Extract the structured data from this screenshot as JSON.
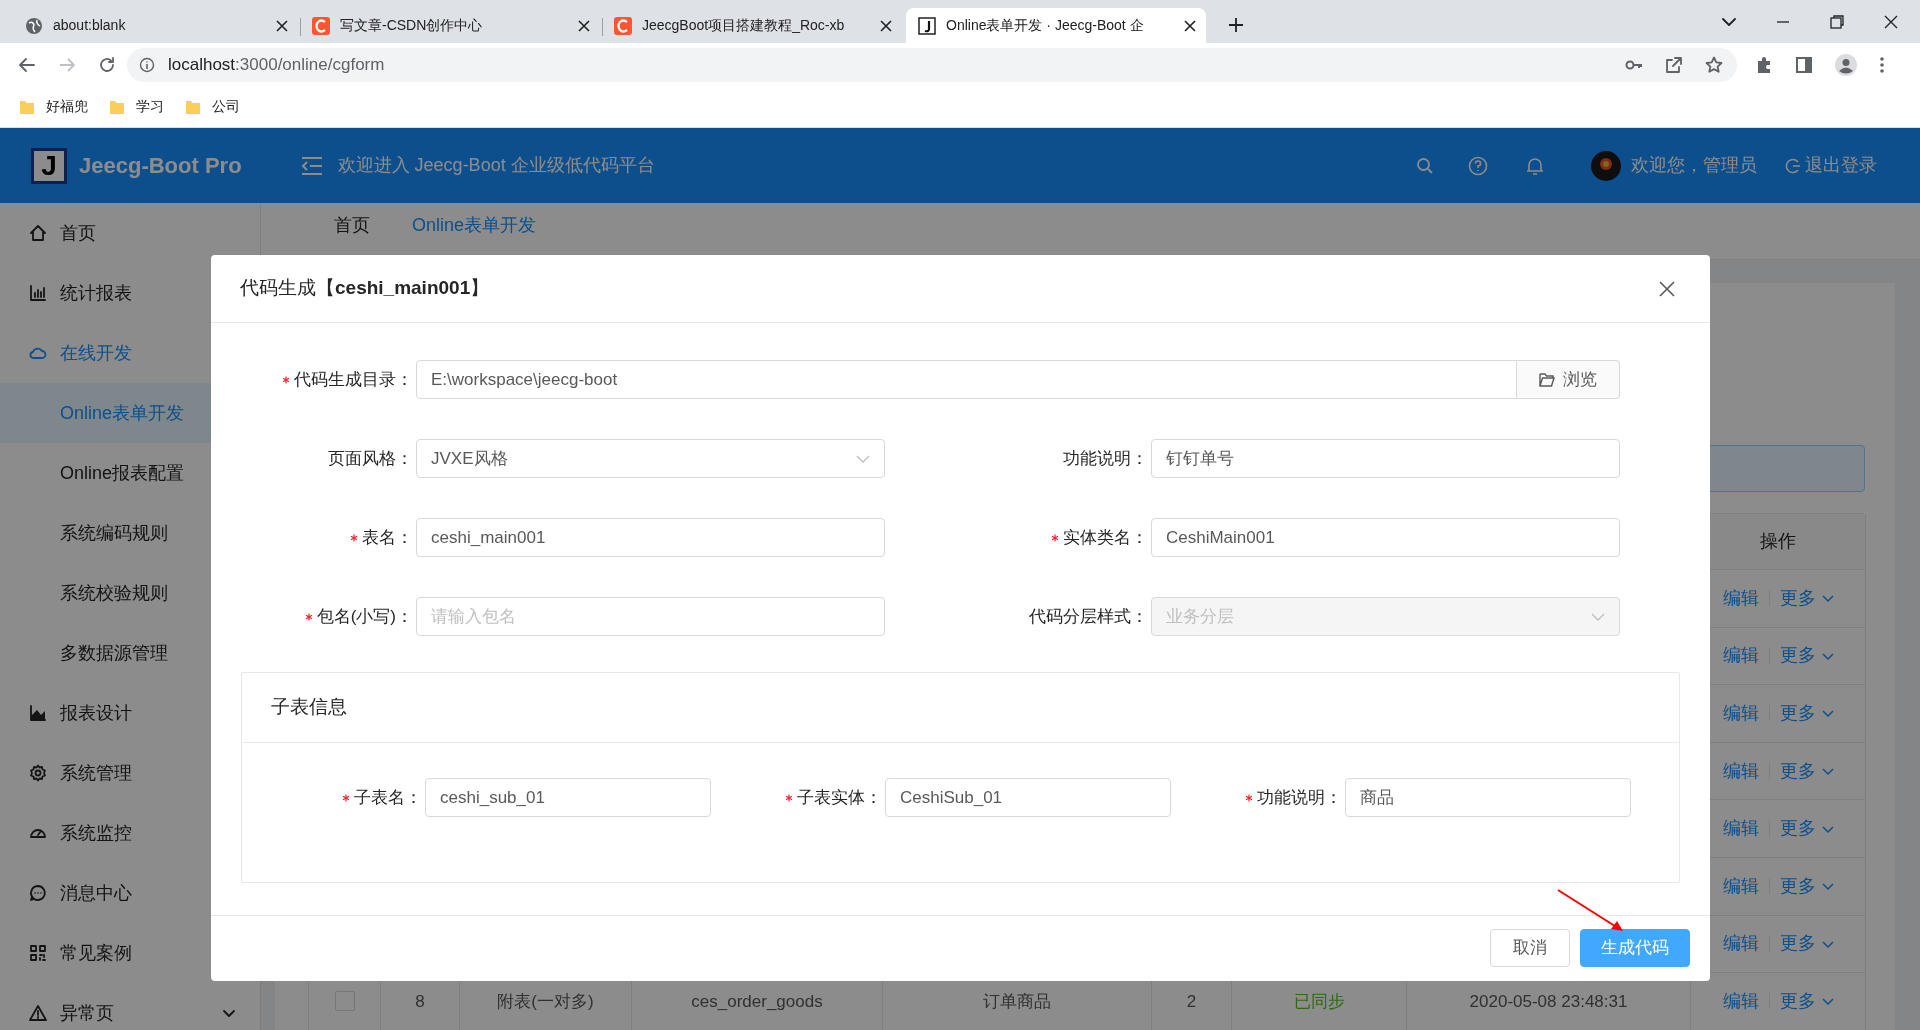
{
  "browser": {
    "tabs": [
      {
        "title": "about:blank",
        "selected": false
      },
      {
        "title": "写文章-CSDN创作中心",
        "selected": false
      },
      {
        "title": "JeecgBoot项目搭建教程_Roc-xb",
        "selected": false
      },
      {
        "title": "Online表单开发 · Jeecg-Boot 企",
        "selected": true
      }
    ],
    "address": {
      "host": "localhost",
      "path": ":3000/online/cgform"
    },
    "bookmarks": [
      "好福兜",
      "学习",
      "公司"
    ]
  },
  "header": {
    "logo": "Jeecg-Boot Pro",
    "logo_mark": "J",
    "welcome": "欢迎进入 Jeecg-Boot 企业级低代码平台",
    "user": "欢迎您，管理员",
    "logout": "退出登录"
  },
  "sidebar": {
    "items": [
      {
        "label": "首页",
        "selected": false
      },
      {
        "label": "统计报表",
        "selected": false
      },
      {
        "label": "在线开发",
        "selected": true,
        "expanded": true,
        "children": [
          {
            "label": "Online表单开发",
            "selected": true
          },
          {
            "label": "Online报表配置",
            "selected": false
          },
          {
            "label": "系统编码规则",
            "selected": false
          },
          {
            "label": "系统校验规则",
            "selected": false
          },
          {
            "label": "多数据源管理",
            "selected": false
          }
        ]
      },
      {
        "label": "报表设计",
        "selected": false
      },
      {
        "label": "系统管理",
        "selected": false
      },
      {
        "label": "系统监控",
        "selected": false
      },
      {
        "label": "消息中心",
        "selected": false
      },
      {
        "label": "常见案例",
        "selected": false
      },
      {
        "label": "异常页",
        "selected": false,
        "expanded": false
      }
    ]
  },
  "page_tabs": [
    {
      "label": "首页",
      "selected": false
    },
    {
      "label": "Online表单开发",
      "selected": true
    }
  ],
  "table": {
    "actions_header": "操作",
    "rows": [
      {
        "actions": [
          "编辑",
          "更多"
        ]
      },
      {
        "actions": [
          "编辑",
          "更多"
        ]
      },
      {
        "actions": [
          "编辑",
          "更多"
        ]
      },
      {
        "actions": [
          "编辑",
          "更多"
        ]
      },
      {
        "actions": [
          "编辑",
          "更多"
        ]
      },
      {
        "actions": [
          "编辑",
          "更多"
        ]
      },
      {
        "actions": [
          "编辑",
          "更多"
        ]
      },
      {
        "checked": false,
        "cells": [
          "8",
          "附表(一对多)",
          "ces_order_goods",
          "订单商品",
          "2",
          "已同步",
          "2020-05-08 23:48:31"
        ],
        "actions": [
          "编辑",
          "更多"
        ]
      }
    ]
  },
  "modal": {
    "title": "代码生成【**ceshi_main001**】",
    "rows": [
      [
        {
          "label": "代码生成目录：",
          "required": true,
          "kind": "path",
          "value": "E:\\workspace\\jeecg-boot",
          "button": "浏览"
        }
      ],
      [
        {
          "label": "页面风格：",
          "required": false,
          "kind": "select",
          "value": "JVXE风格",
          "disabled": false
        },
        {
          "label": "功能说明：",
          "required": false,
          "kind": "input",
          "value": "钉钉单号"
        }
      ],
      [
        {
          "label": "表名：",
          "required": true,
          "kind": "input",
          "value": "ceshi_main001"
        },
        {
          "label": "实体类名：",
          "required": true,
          "kind": "input",
          "value": "CeshiMain001"
        }
      ],
      [
        {
          "label": "包名(小写)：",
          "required": true,
          "kind": "input",
          "placeholder": "请输入包名"
        },
        {
          "label": "代码分层样式：",
          "required": false,
          "kind": "select",
          "value": "业务分层",
          "disabled": true
        }
      ]
    ],
    "sub_section": {
      "title": "子表信息",
      "fields": [
        {
          "label": "子表名：",
          "required": true,
          "value": "ceshi_sub_01"
        },
        {
          "label": "子表实体：",
          "required": true,
          "value": "CeshiSub_01"
        },
        {
          "label": "功能说明：",
          "required": true,
          "value": "商品"
        }
      ]
    },
    "buttons": [
      {
        "label": "取消",
        "kind": "default"
      },
      {
        "label": "生成代码",
        "kind": "primary"
      }
    ]
  }
}
